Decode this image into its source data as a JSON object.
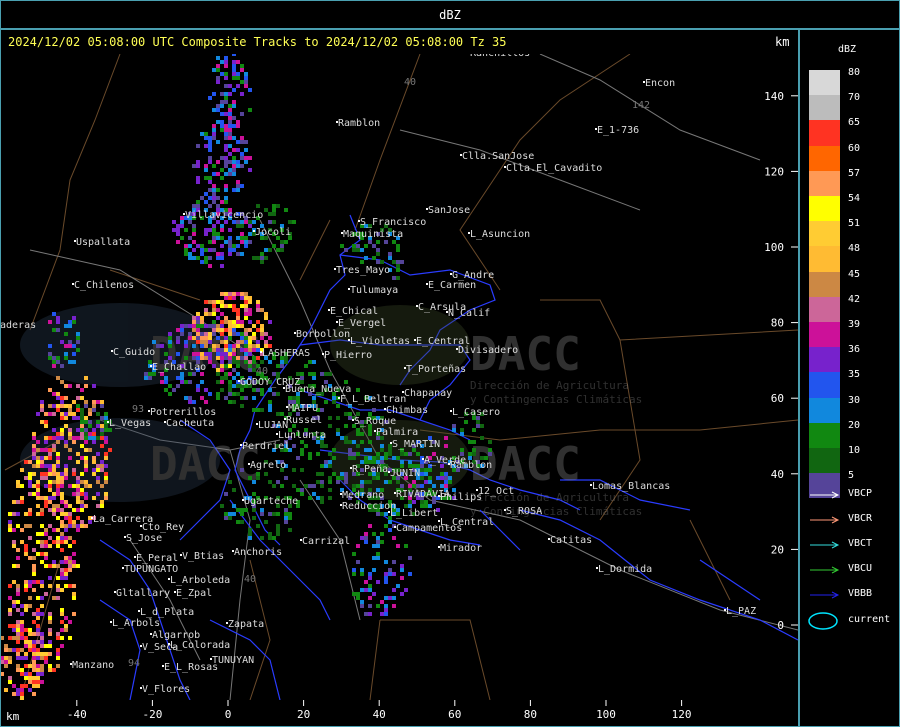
{
  "window": {
    "title": "dBZ"
  },
  "header": {
    "text": "2024/12/02 05:08:00 UTC Composite Tracks to 2024/12/02 05:08:00 Tz 35",
    "unit_top": "km",
    "unit_bottom": "km"
  },
  "axes": {
    "x_ticks": [
      "-40",
      "-20",
      "0",
      "20",
      "40",
      "60",
      "80",
      "100",
      "120"
    ],
    "x_values": [
      -40,
      -20,
      0,
      20,
      40,
      60,
      80,
      100,
      120
    ],
    "y_ticks": [
      "140",
      "120",
      "100",
      "80",
      "60",
      "40",
      "20",
      "0"
    ],
    "y_values": [
      140,
      120,
      100,
      80,
      60,
      40,
      20,
      0
    ]
  },
  "legend": {
    "title": "dBZ",
    "scale": [
      {
        "label": "80",
        "color": "#d8d8d8"
      },
      {
        "label": "70",
        "color": "#bcbcbc"
      },
      {
        "label": "65",
        "color": "#ff3322"
      },
      {
        "label": "60",
        "color": "#ff6600"
      },
      {
        "label": "57",
        "color": "#ff9955"
      },
      {
        "label": "54",
        "color": "#ffff00"
      },
      {
        "label": "51",
        "color": "#ffcc33"
      },
      {
        "label": "48",
        "color": "#ffbb33"
      },
      {
        "label": "45",
        "color": "#cc8844"
      },
      {
        "label": "42",
        "color": "#cc6699"
      },
      {
        "label": "39",
        "color": "#cc1199"
      },
      {
        "label": "36",
        "color": "#7722cc"
      },
      {
        "label": "35",
        "color": "#2255ee"
      },
      {
        "label": "30",
        "color": "#1188dd"
      },
      {
        "label": "20",
        "color": "#118811"
      },
      {
        "label": "10",
        "color": "#116611"
      },
      {
        "label": "5",
        "color": "#554499"
      }
    ],
    "tracks": [
      {
        "label": "VBCP",
        "color": "#ffffff"
      },
      {
        "label": "VBCR",
        "color": "#ff9977"
      },
      {
        "label": "VBCT",
        "color": "#33dddd"
      },
      {
        "label": "VBCU",
        "color": "#33cc33"
      },
      {
        "label": "VBBB",
        "color": "#2222ee"
      }
    ],
    "current_label": "current",
    "current_color": "#00e5ff"
  },
  "watermark": {
    "brand": "DACC",
    "line1": "Dirección de Agricultura",
    "line2": "y Contingencias Climáticas"
  },
  "places": [
    {
      "name": "Ranchillos",
      "x": 470,
      "y": 52
    },
    {
      "name": "Encon",
      "x": 645,
      "y": 82
    },
    {
      "name": "Ramblon",
      "x": 338,
      "y": 122
    },
    {
      "name": "E_1-736",
      "x": 597,
      "y": 129
    },
    {
      "name": "Clla.SanJose",
      "x": 462,
      "y": 155
    },
    {
      "name": "Clla.El_Cavadito",
      "x": 506,
      "y": 167
    },
    {
      "name": "Uspallata",
      "x": 76,
      "y": 241
    },
    {
      "name": "S_Francisco",
      "x": 360,
      "y": 221
    },
    {
      "name": "SanJose",
      "x": 428,
      "y": 209
    },
    {
      "name": "L_Asuncion",
      "x": 470,
      "y": 233
    },
    {
      "name": "Maquinista",
      "x": 343,
      "y": 233
    },
    {
      "name": "Villavicencio",
      "x": 185,
      "y": 214
    },
    {
      "name": "Jocoli",
      "x": 255,
      "y": 231
    },
    {
      "name": "Tres_Mayo",
      "x": 336,
      "y": 269
    },
    {
      "name": "G_Andre",
      "x": 452,
      "y": 274
    },
    {
      "name": "C_Chilenos",
      "x": 74,
      "y": 284
    },
    {
      "name": "Tulumaya",
      "x": 350,
      "y": 289
    },
    {
      "name": "E_Carmen",
      "x": 428,
      "y": 284
    },
    {
      "name": "E_Chical",
      "x": 330,
      "y": 310
    },
    {
      "name": "C_Arsula",
      "x": 418,
      "y": 306
    },
    {
      "name": "N_Calif",
      "x": 448,
      "y": 312
    },
    {
      "name": "E_Vergel",
      "x": 338,
      "y": 322
    },
    {
      "name": "aderas",
      "x": 0,
      "y": 324
    },
    {
      "name": "Borbollon",
      "x": 296,
      "y": 333
    },
    {
      "name": "L_Violetas",
      "x": 350,
      "y": 340
    },
    {
      "name": "E_Central",
      "x": 416,
      "y": 340
    },
    {
      "name": "Divisadero",
      "x": 458,
      "y": 349
    },
    {
      "name": "C_Guido",
      "x": 113,
      "y": 351
    },
    {
      "name": "LASHERAS",
      "x": 262,
      "y": 352
    },
    {
      "name": "P_Hierro",
      "x": 324,
      "y": 354
    },
    {
      "name": "E_Challao",
      "x": 152,
      "y": 366
    },
    {
      "name": "T_Porteñas",
      "x": 406,
      "y": 368
    },
    {
      "name": "GODOY_CRUZ",
      "x": 240,
      "y": 381
    },
    {
      "name": "Buena_Nueva",
      "x": 285,
      "y": 388
    },
    {
      "name": "Chapanay",
      "x": 404,
      "y": 392
    },
    {
      "name": "F_L_Beltran",
      "x": 340,
      "y": 398
    },
    {
      "name": "Potrerillos",
      "x": 150,
      "y": 411
    },
    {
      "name": "MAIPU",
      "x": 288,
      "y": 407
    },
    {
      "name": "Chimbas",
      "x": 386,
      "y": 409
    },
    {
      "name": "L_Casero",
      "x": 452,
      "y": 411
    },
    {
      "name": "L_Vegas",
      "x": 109,
      "y": 422
    },
    {
      "name": "Cacheuta",
      "x": 166,
      "y": 422
    },
    {
      "name": "Russel",
      "x": 286,
      "y": 419
    },
    {
      "name": "S_Roque",
      "x": 354,
      "y": 420
    },
    {
      "name": "LUJAN",
      "x": 258,
      "y": 424
    },
    {
      "name": "Lunlunta",
      "x": 278,
      "y": 434
    },
    {
      "name": "Palmira",
      "x": 376,
      "y": 431
    },
    {
      "name": "Perdriel",
      "x": 242,
      "y": 445
    },
    {
      "name": "S_MARTIN",
      "x": 392,
      "y": 443
    },
    {
      "name": "A_Verde",
      "x": 424,
      "y": 459
    },
    {
      "name": "Ramblon",
      "x": 450,
      "y": 464
    },
    {
      "name": "Agrelo",
      "x": 250,
      "y": 464
    },
    {
      "name": "R_Peña",
      "x": 352,
      "y": 468
    },
    {
      "name": "JUNIN",
      "x": 390,
      "y": 472
    },
    {
      "name": "Lomas_Blancas",
      "x": 592,
      "y": 485
    },
    {
      "name": "12_Oct",
      "x": 478,
      "y": 490
    },
    {
      "name": "Medrano",
      "x": 342,
      "y": 494
    },
    {
      "name": "RIVADAVIA",
      "x": 396,
      "y": 493
    },
    {
      "name": "Philips",
      "x": 440,
      "y": 496
    },
    {
      "name": "Ugarteche",
      "x": 244,
      "y": 500
    },
    {
      "name": "Reduccion",
      "x": 342,
      "y": 505
    },
    {
      "name": "L_Libert",
      "x": 390,
      "y": 512
    },
    {
      "name": "S_ROSA",
      "x": 506,
      "y": 510
    },
    {
      "name": "La_Carrera",
      "x": 93,
      "y": 518
    },
    {
      "name": "L_Central",
      "x": 440,
      "y": 521
    },
    {
      "name": "Cto_Rey",
      "x": 142,
      "y": 526
    },
    {
      "name": "Campamentos",
      "x": 396,
      "y": 527
    },
    {
      "name": "S_Jose",
      "x": 126,
      "y": 537
    },
    {
      "name": "Carrizal",
      "x": 302,
      "y": 540
    },
    {
      "name": "Catitas",
      "x": 550,
      "y": 539
    },
    {
      "name": "Anchoris",
      "x": 234,
      "y": 551
    },
    {
      "name": "Mirador",
      "x": 440,
      "y": 547
    },
    {
      "name": "E_Peral",
      "x": 136,
      "y": 557
    },
    {
      "name": "V_Btias",
      "x": 182,
      "y": 555
    },
    {
      "name": "TUPUNGATO",
      "x": 124,
      "y": 568
    },
    {
      "name": "L_Dormida",
      "x": 598,
      "y": 568
    },
    {
      "name": "L_Arboleda",
      "x": 170,
      "y": 579
    },
    {
      "name": "Gltallary",
      "x": 116,
      "y": 592
    },
    {
      "name": "E_Zpal",
      "x": 176,
      "y": 592
    },
    {
      "name": "L_d_Plata",
      "x": 140,
      "y": 611
    },
    {
      "name": "L_PAZ",
      "x": 726,
      "y": 610
    },
    {
      "name": "L_Arbols",
      "x": 112,
      "y": 622
    },
    {
      "name": "Zapata",
      "x": 228,
      "y": 623
    },
    {
      "name": "Algarrob",
      "x": 152,
      "y": 634
    },
    {
      "name": "L_Colorada",
      "x": 170,
      "y": 644
    },
    {
      "name": "V_Seca",
      "x": 142,
      "y": 646
    },
    {
      "name": "TUNUYAN",
      "x": 212,
      "y": 659
    },
    {
      "name": "Manzano",
      "x": 72,
      "y": 664
    },
    {
      "name": "E_L_Rosas",
      "x": 164,
      "y": 666
    },
    {
      "name": "V_Flores",
      "x": 142,
      "y": 688
    }
  ],
  "road_numbers": [
    {
      "name": "40",
      "x": 404,
      "y": 85
    },
    {
      "name": "142",
      "x": 632,
      "y": 108
    },
    {
      "name": "40",
      "x": 256,
      "y": 374
    },
    {
      "name": "93",
      "x": 132,
      "y": 412
    },
    {
      "name": "40",
      "x": 244,
      "y": 582
    },
    {
      "name": "94",
      "x": 128,
      "y": 666
    }
  ]
}
